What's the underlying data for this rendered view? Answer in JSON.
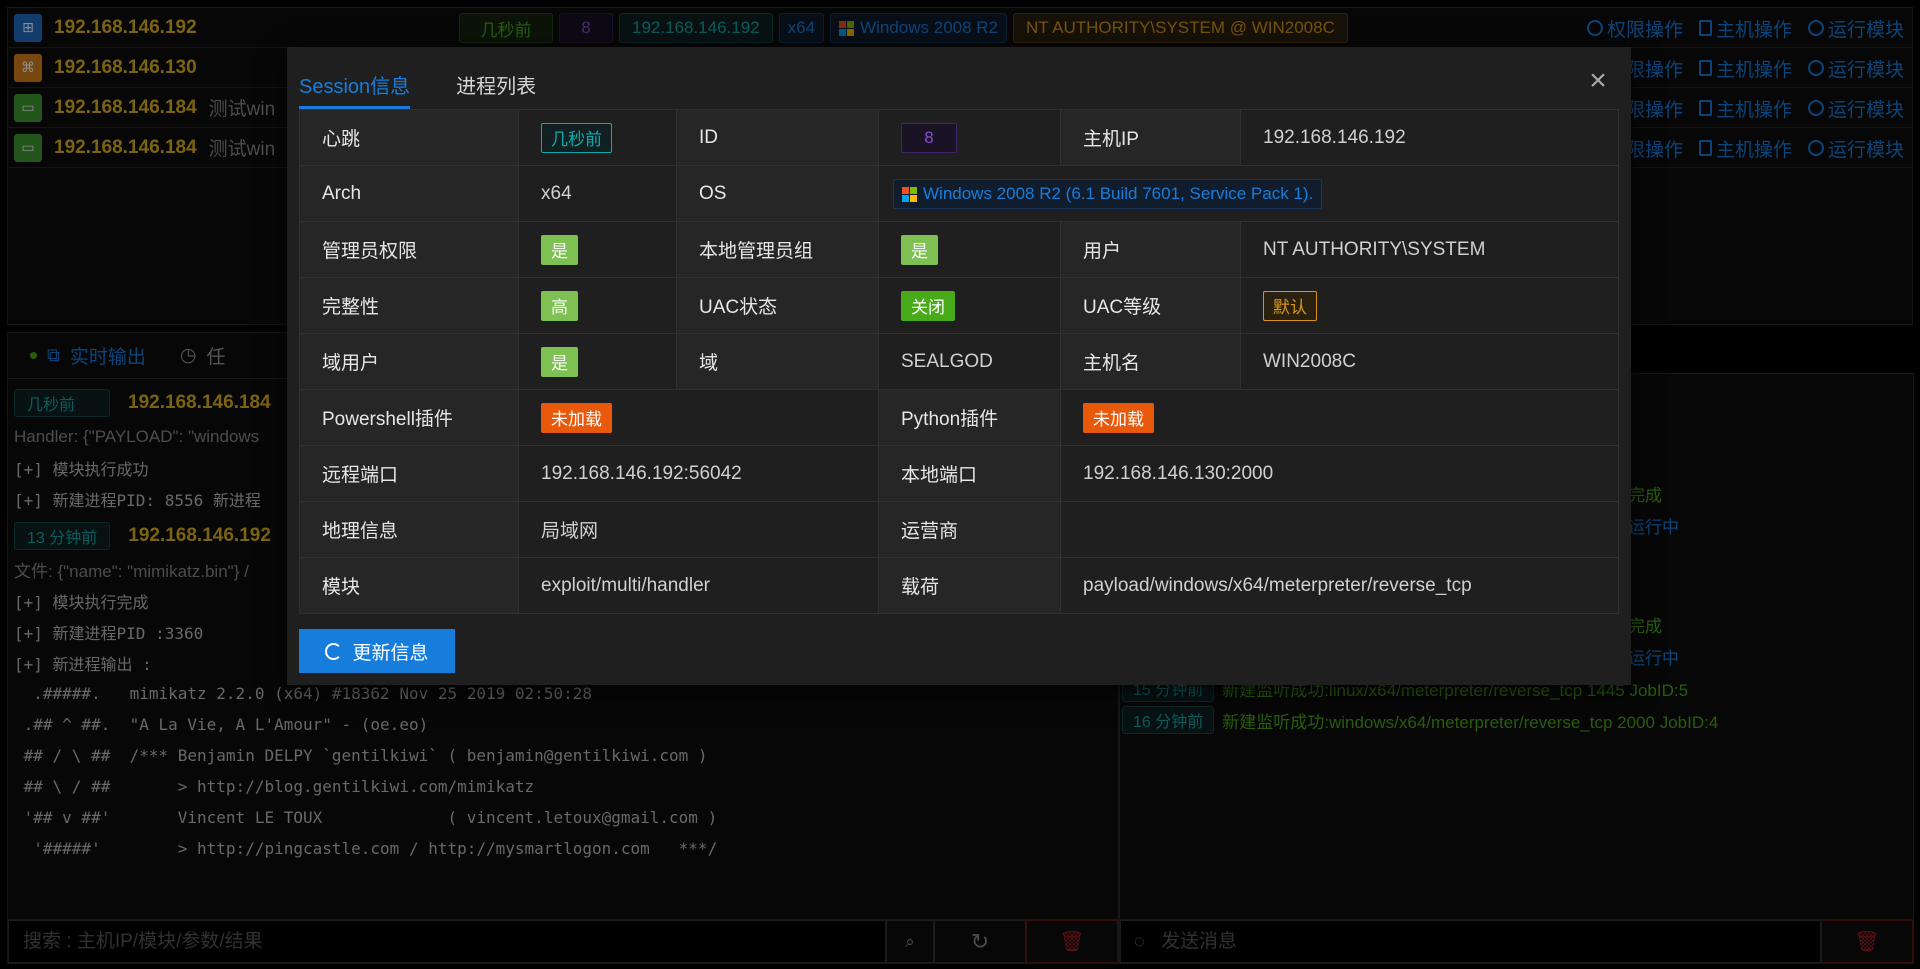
{
  "sessions": [
    {
      "ip": "192.168.146.192",
      "comment": "",
      "icon": "windows-icon"
    },
    {
      "ip": "192.168.146.130",
      "comment": "",
      "icon": "linux-icon"
    },
    {
      "ip": "192.168.146.184",
      "comment": "测试win",
      "icon": "desktop-icon"
    },
    {
      "ip": "192.168.146.184",
      "comment": "测试win",
      "icon": "desktop-icon"
    }
  ],
  "first_row_tags": {
    "heartbeat": "几秒前",
    "id": "8",
    "host": "192.168.146.192",
    "arch": "x64",
    "os": "Windows 2008 R2",
    "user": "NT AUTHORITY\\SYSTEM @ WIN2008C"
  },
  "row_actions": {
    "privilege": "权限操作",
    "host": "主机操作",
    "module": "运行模块"
  },
  "left_tabs": {
    "realtime": "实时输出",
    "task": "任"
  },
  "log": {
    "entry1": {
      "time": "几秒前",
      "ip": "192.168.146.184",
      "handler": "Handler: {\"PAYLOAD\": \"windows",
      "l1": "[+] 模块执行成功",
      "l2": "[+] 新建进程PID: 8556 新进程"
    },
    "entry2": {
      "time": "13 分钟前",
      "ip": "192.168.146.192",
      "file": "文件: {\"name\": \"mimikatz.bin\"} /",
      "l1": "[+] 模块执行完成",
      "l2": "[+] 新建进程PID :3360",
      "l3": "[+] 新进程输出 :"
    },
    "mimikatz": [
      "  .#####.   mimikatz 2.2.0 (x64) #18362 Nov 25 2019 02:50:28",
      " .## ^ ##.  \"A La Vie, A L'Amour\" - (oe.eo)",
      " ## / \\ ##  /*** Benjamin DELPY `gentilkiwi` ( benjamin@gentilkiwi.com )",
      " ## \\ / ##       > http://blog.gentilkiwi.com/mimikatz",
      " '## v ##'       Vincent LE TOUX             ( vincent.letoux@gmail.com )",
      "  '#####'        > http://pingcastle.com / http://mysmartlogon.com   ***/"
    ]
  },
  "search": {
    "placeholder": "搜索 : 主机IP/模块/参数/结果"
  },
  "right_log": {
    "m1": "完成",
    "m2": "运行中",
    "m3": "完成",
    "m4": "运行中",
    "m5_time": "15 分钟前",
    "m5": "新建监听成功:linux/x64/meterpreter/reverse_tcp 1445 JobID:5",
    "m6_time": "16 分钟前",
    "m6": "新建监听成功:windows/x64/meterpreter/reverse_tcp 2000 JobID:4"
  },
  "message": {
    "placeholder": "发送消息"
  },
  "modal": {
    "tabs": {
      "session": "Session信息",
      "process": "进程列表"
    },
    "close": "×",
    "labels": {
      "heartbeat": "心跳",
      "id": "ID",
      "host_ip": "主机IP",
      "arch": "Arch",
      "os": "OS",
      "admin": "管理员权限",
      "local_admin": "本地管理员组",
      "user": "用户",
      "integrity": "完整性",
      "uac": "UAC状态",
      "uac_level": "UAC等级",
      "domain_user": "域用户",
      "domain": "域",
      "hostname": "主机名",
      "powershell": "Powershell插件",
      "python": "Python插件",
      "remote_port": "远程端口",
      "local_port": "本地端口",
      "geo": "地理信息",
      "isp": "运营商",
      "module": "模块",
      "payload": "载荷"
    },
    "values": {
      "heartbeat": "几秒前",
      "id": "8",
      "host_ip": "192.168.146.192",
      "arch": "x64",
      "os": "Windows 2008 R2 (6.1 Build 7601, Service Pack 1).",
      "admin": "是",
      "local_admin": "是",
      "user": "NT AUTHORITY\\SYSTEM",
      "integrity": "高",
      "uac": "关闭",
      "uac_level": "默认",
      "domain_user": "是",
      "domain": "SEALGOD",
      "hostname": "WIN2008C",
      "powershell": "未加载",
      "python": "未加载",
      "remote_port": "192.168.146.192:56042",
      "local_port": "192.168.146.130:2000",
      "geo": "局域网",
      "isp": "",
      "module": "exploit/multi/handler",
      "payload": "payload/windows/x64/meterpreter/reverse_tcp"
    },
    "update_button": "更新信息"
  }
}
